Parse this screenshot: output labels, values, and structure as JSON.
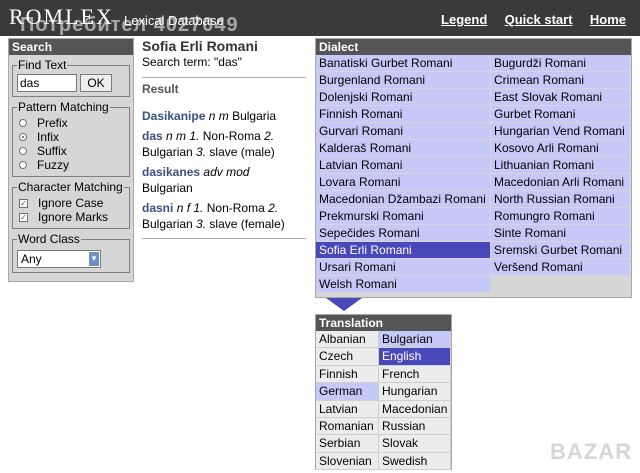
{
  "header": {
    "logo": "ROMLEX",
    "subtitle": "Lexical Database",
    "watermark": "Потребител 4027049",
    "nav": [
      {
        "label": "Legend"
      },
      {
        "label": "Quick start"
      },
      {
        "label": "Home"
      }
    ]
  },
  "search_panel": {
    "title": "Search",
    "find_text": {
      "legend": "Find Text",
      "value": "das",
      "ok_label": "OK"
    },
    "pattern_matching": {
      "legend": "Pattern Matching",
      "options": [
        {
          "label": "Prefix",
          "selected": false
        },
        {
          "label": "Infix",
          "selected": true
        },
        {
          "label": "Suffix",
          "selected": false
        },
        {
          "label": "Fuzzy",
          "selected": false
        }
      ]
    },
    "character_matching": {
      "legend": "Character Matching",
      "options": [
        {
          "label": "Ignore Case",
          "checked": true
        },
        {
          "label": "Ignore Marks",
          "checked": true
        }
      ]
    },
    "word_class": {
      "legend": "Word Class",
      "value": "Any"
    }
  },
  "results": {
    "dictionary_title": "Sofia Erli Romani",
    "search_term": "Search term: \"das\"",
    "heading": "Result",
    "entries": [
      {
        "headword": "Dasikanipe",
        "pos": "n m",
        "gloss": "Bulgaria"
      },
      {
        "headword": "das",
        "pos": "n m",
        "gloss_1": "Non-Roma",
        "gloss_2": "Bulgarian",
        "gloss_3": "slave (male)"
      },
      {
        "headword": "dasikanes",
        "pos": "adv mod",
        "gloss": "Bulgarian"
      },
      {
        "headword": "dasni",
        "pos": "n f",
        "gloss_1": "Non-Roma",
        "gloss_2": "Bulgarian",
        "gloss_3": "slave (female)"
      }
    ],
    "sense_numbers": [
      "1.",
      "2.",
      "3."
    ]
  },
  "dialect_panel": {
    "title": "Dialect",
    "selected": "Sofia Erli Romani",
    "column_1": [
      "Banatiski Gurbet Romani",
      "Burgenland Romani",
      "Dolenjski Romani",
      "Finnish Romani",
      "Gurvari Romani",
      "Kalderaš Romani",
      "Latvian Romani",
      "Lovara Romani",
      "Macedonian Džambazi Romani",
      "Prekmurski Romani",
      "Sepečides Romani",
      "Sofia Erli Romani",
      "Ursari Romani",
      "Welsh Romani"
    ],
    "column_2": [
      "Bugurdži Romani",
      "Crimean Romani",
      "East Slovak Romani",
      "Gurbet Romani",
      "Hungarian Vend Romani",
      "Kosovo Arli Romani",
      "Lithuanian Romani",
      "Macedonian Arli Romani",
      "North Russian Romani",
      "Romungro Romani",
      "Sinte Romani",
      "Sremski Gurbet Romani",
      "Veršend Romani"
    ]
  },
  "translation_panel": {
    "title": "Translation",
    "selected": "English",
    "highlighted": [
      "Bulgarian",
      "German"
    ],
    "languages": [
      "Albanian",
      "Bulgarian",
      "Czech",
      "English",
      "Finnish",
      "French",
      "German",
      "Hungarian",
      "Latvian",
      "Macedonian",
      "Romanian",
      "Russian",
      "Serbian",
      "Slovak",
      "Slovenian",
      "Swedish"
    ]
  },
  "site_badge": "BAZAR",
  "colors": {
    "header_bg": "#3a3a3a",
    "panel_title_bg": "#555555",
    "list_bg": "#c6c8f8",
    "selected_bg": "#4848b8",
    "headword": "#3a4f80"
  }
}
